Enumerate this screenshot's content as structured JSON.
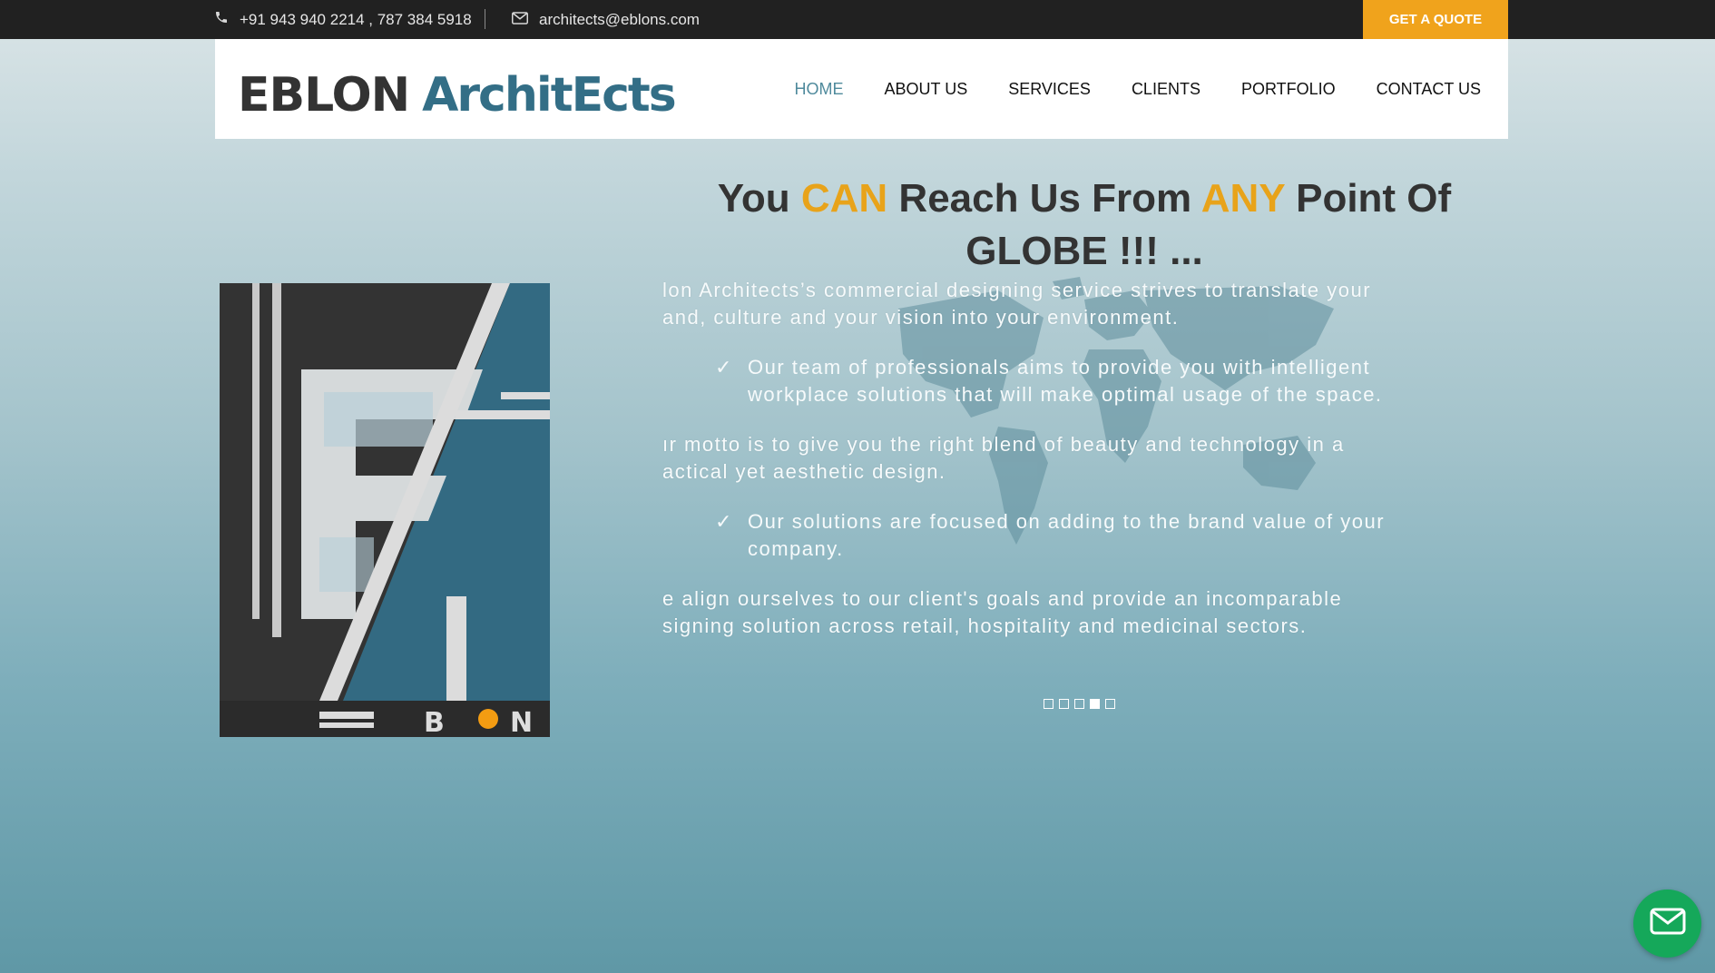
{
  "topbar": {
    "phone": "+91 943 940 2214 , 787 384 5918",
    "email": "architects@eblons.com",
    "quote_label": "GET A QUOTE"
  },
  "logo": {
    "word1": "EBLON",
    "word2": "ArchitEcts"
  },
  "nav": [
    "HOME",
    "ABOUT US",
    "SERVICES",
    "CLIENTS",
    "PORTFOLIO",
    "CONTACT US"
  ],
  "hero": {
    "headline": {
      "p1": "You ",
      "h1": "CAN",
      "p2": " Reach Us From ",
      "h2": "ANY",
      "p3": " Point Of",
      "line2": "GLOBE !!! ..."
    },
    "para1_l1": "lon Architects’s commercial designing service strives to translate your",
    "para1_l2": "and, culture and your vision into your environment.",
    "bullet1_l1": "Our team of professionals aims to provide you with intelligent",
    "bullet1_l2": "workplace solutions that will make optimal usage of the space.",
    "para2_l1": "ır motto is to give you the right blend of beauty and technology in a",
    "para2_l2": "actical yet aesthetic design.",
    "bullet2_l1": "Our solutions are focused on adding to the brand value of your",
    "bullet2_l2": "company.",
    "para3_l1": "e align ourselves to our client's goals and provide an incomparable",
    "para3_l2": "signing solution across retail, hospitality and medicinal sectors.",
    "tick": "✓",
    "slider_active_index": 3,
    "slider_count": 5
  },
  "colors": {
    "accent": "#f0a31c",
    "brand_blue": "#336e86",
    "topbar": "#212121",
    "fab": "#15a85a"
  }
}
